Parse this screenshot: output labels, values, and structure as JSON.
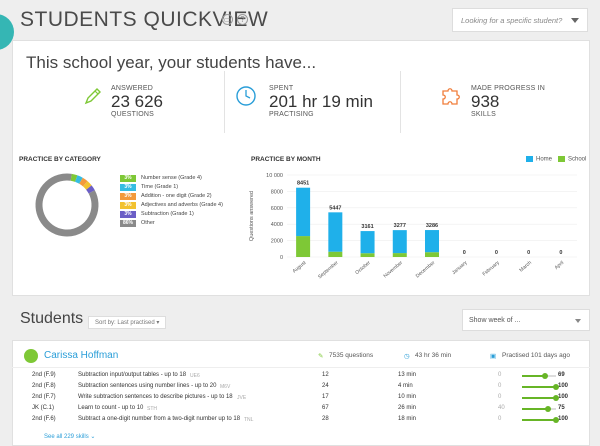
{
  "header": {
    "title": "STUDENTS QUICKVIEW",
    "search_placeholder": "Looking for a specific student?"
  },
  "summary": {
    "intro": "This school year, your students have...",
    "stats": [
      {
        "label": "ANSWERED",
        "value": "23 626",
        "unit": "QUESTIONS",
        "icon": "pencil-icon",
        "color": "#7ec836"
      },
      {
        "label": "SPENT",
        "value": "201 hr 19 min",
        "unit": "PRACTISING",
        "icon": "clock-icon",
        "color": "#2a9ed8"
      },
      {
        "label": "MADE PROGRESS IN",
        "value": "938",
        "unit": "SKILLS",
        "icon": "puzzle-icon",
        "color": "#f07d3a"
      }
    ]
  },
  "category": {
    "title": "PRACTICE BY CATEGORY",
    "items": [
      {
        "pct": "3%",
        "label": "Number sense (Grade 4)",
        "color": "#7ec836"
      },
      {
        "pct": "3%",
        "label": "Time (Grade 1)",
        "color": "#36bde2"
      },
      {
        "pct": "3%",
        "label": "Addition - one digit (Grade 2)",
        "color": "#f39a3c"
      },
      {
        "pct": "3%",
        "label": "Adjectives and adverbs (Grade 4)",
        "color": "#f2c230"
      },
      {
        "pct": "3%",
        "label": "Subtraction (Grade 1)",
        "color": "#6b5ec6"
      },
      {
        "pct": "86%",
        "label": "Other",
        "color": "#8a8a8a"
      }
    ]
  },
  "chart_data": {
    "type": "bar",
    "title": "PRACTICE BY MONTH",
    "ylabel": "Questions answered",
    "ylim": [
      0,
      10000
    ],
    "yticks": [
      "10 000",
      "8000",
      "6000",
      "4000",
      "2000",
      "0"
    ],
    "categories": [
      "August",
      "September",
      "October",
      "November",
      "December",
      "January",
      "February",
      "March",
      "April"
    ],
    "totals": [
      8451,
      5447,
      3161,
      3277,
      3286,
      0,
      0,
      0,
      0
    ],
    "series": [
      {
        "name": "Home",
        "color": "#1fb0ea",
        "values": [
          5900,
          4800,
          2700,
          2800,
          2700,
          0,
          0,
          0,
          0
        ]
      },
      {
        "name": "School",
        "color": "#7ec836",
        "values": [
          2551,
          647,
          461,
          477,
          586,
          0,
          0,
          0,
          0
        ]
      }
    ],
    "total_labels": [
      "8451",
      "5447",
      "3161",
      "3277",
      "3286",
      "0",
      "0",
      "0",
      "0"
    ],
    "legend": "top-right"
  },
  "students_section": {
    "title": "Students",
    "sort_label": "Sort by: Last practised ▾",
    "week_label": "Show week of ..."
  },
  "student": {
    "name": "Carissa Hoffman",
    "questions": "7535 questions",
    "time": "43 hr 36 min",
    "practised": "Practised 101 days ago",
    "rows": [
      {
        "grade": "2nd (F.9)",
        "skill": "Subtraction input/output tables - up to 18",
        "code": "UE6",
        "q": "12",
        "time": "13 min",
        "start": "0",
        "score": "69",
        "fill": 0.69
      },
      {
        "grade": "2nd (F.8)",
        "skill": "Subtraction sentences using number lines - up to 20",
        "code": "M6V",
        "q": "24",
        "time": "4 min",
        "start": "0",
        "score": "100",
        "fill": 1.0
      },
      {
        "grade": "2nd (F.7)",
        "skill": "Write subtraction sentences to describe pictures - up to 18",
        "code": "JVE",
        "q": "17",
        "time": "10 min",
        "start": "0",
        "score": "100",
        "fill": 1.0
      },
      {
        "grade": "JK (C.1)",
        "skill": "Learn to count - up to 10",
        "code": "STH",
        "q": "67",
        "time": "26 min",
        "start": "40",
        "score": "75",
        "fill": 0.75
      },
      {
        "grade": "2nd (F.6)",
        "skill": "Subtract a one-digit number from a two-digit number up to 18",
        "code": "TNL",
        "q": "28",
        "time": "18 min",
        "start": "0",
        "score": "100",
        "fill": 1.0
      }
    ],
    "see_all": "See all 229 skills ⌄"
  }
}
